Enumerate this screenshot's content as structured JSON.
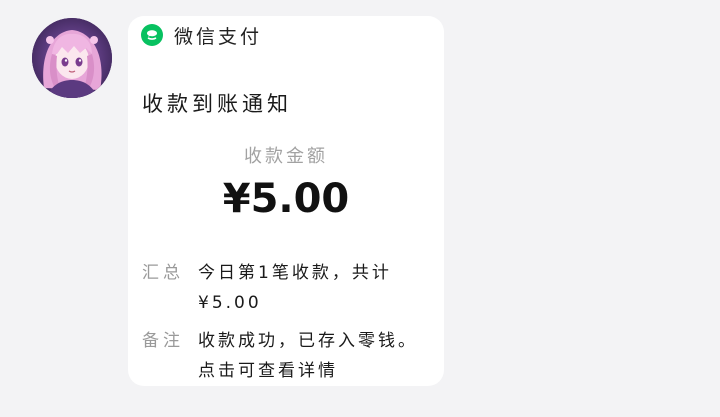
{
  "message": {
    "avatar_icon": "anime-girl-avatar",
    "brand_color": "#07c160",
    "header": {
      "icon": "wechat-pay-icon",
      "label": "微信支付"
    },
    "title": "收款到账通知",
    "amount": {
      "label": "收款金额",
      "value": "¥5.00"
    },
    "summary": {
      "label": "汇总",
      "lines": [
        "今日第1笔收款，共计",
        "¥5.00"
      ]
    },
    "note": {
      "label": "备注",
      "lines": [
        "收款成功，已存入零钱。",
        "点击可查看详情"
      ]
    }
  }
}
